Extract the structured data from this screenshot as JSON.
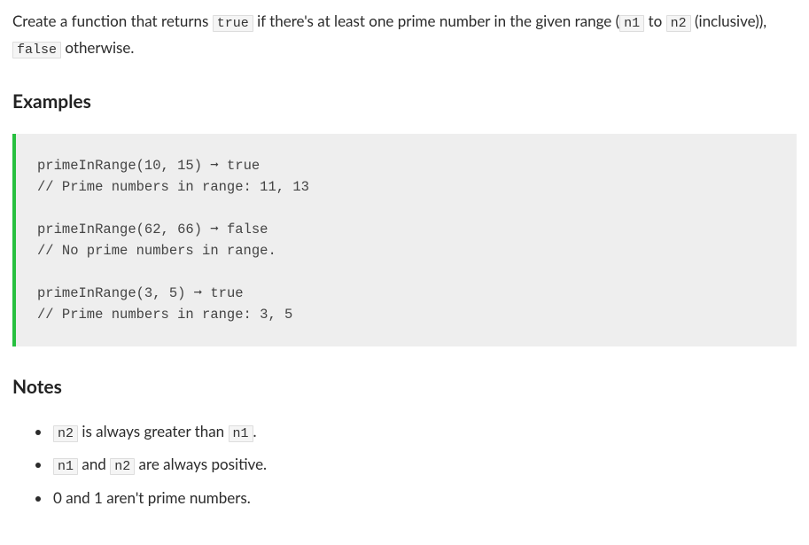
{
  "description": {
    "part1": "Create a function that returns ",
    "code1": "true",
    "part2": " if there's at least one prime number in the given range (",
    "code2": "n1",
    "part3": " to ",
    "code3": "n2",
    "part4": " (inclusive)), ",
    "code4": "false",
    "part5": " otherwise."
  },
  "examples": {
    "heading": "Examples",
    "code": "primeInRange(10, 15) ➞ true\n// Prime numbers in range: 11, 13\n\nprimeInRange(62, 66) ➞ false\n// No prime numbers in range.\n\nprimeInRange(3, 5) ➞ true\n// Prime numbers in range: 3, 5"
  },
  "notes": {
    "heading": "Notes",
    "items": [
      {
        "pre": "",
        "code1": "n2",
        "mid": " is always greater than ",
        "code2": "n1",
        "post": "."
      },
      {
        "pre": "",
        "code1": "n1",
        "mid": " and ",
        "code2": "n2",
        "post": " are always positive."
      },
      {
        "pre": "0 and 1 aren't prime numbers.",
        "code1": null,
        "mid": "",
        "code2": null,
        "post": ""
      }
    ]
  }
}
